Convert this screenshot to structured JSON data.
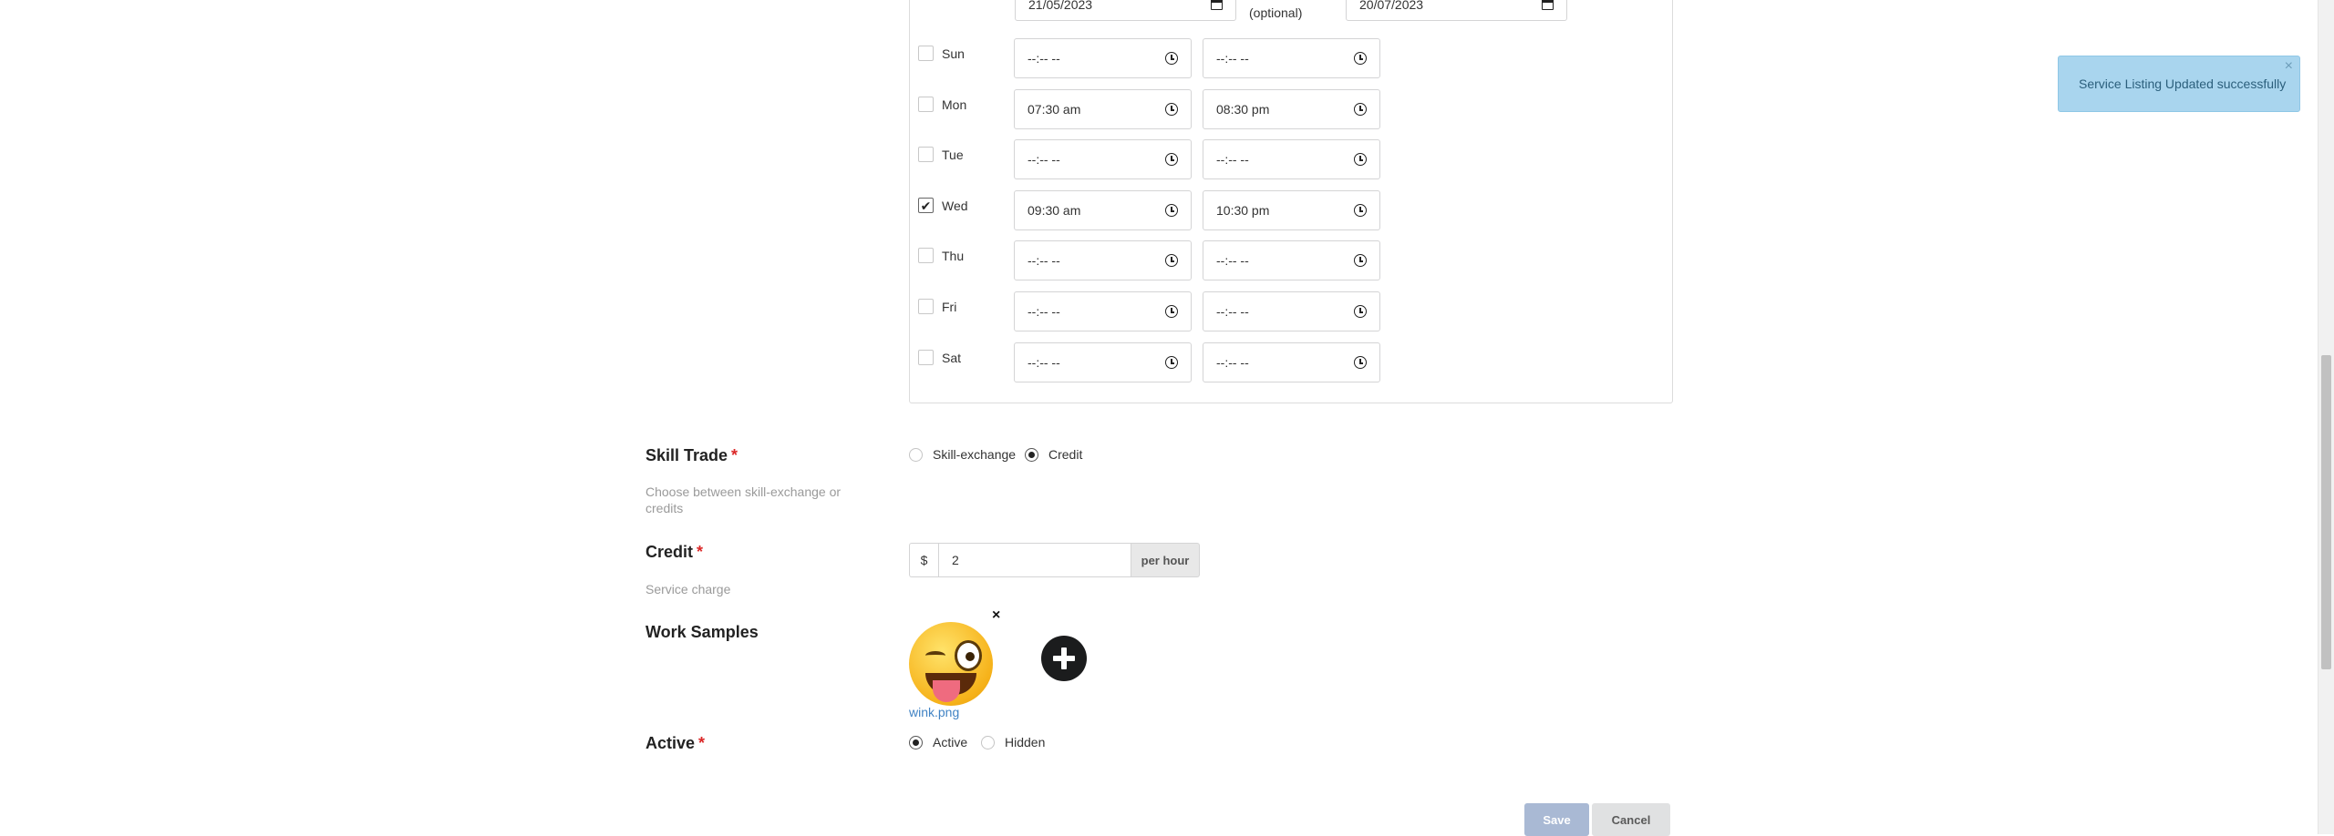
{
  "schedule": {
    "start_date": "21/05/2023",
    "optional_label": "(optional)",
    "end_date": "20/07/2023",
    "days": [
      {
        "label": "Sun",
        "checked": false,
        "from": "--:-- --",
        "to": "--:-- --"
      },
      {
        "label": "Mon",
        "checked": false,
        "from": "07:30 am",
        "to": "08:30 pm"
      },
      {
        "label": "Tue",
        "checked": false,
        "from": "--:-- --",
        "to": "--:-- --"
      },
      {
        "label": "Wed",
        "checked": true,
        "from": "09:30 am",
        "to": "10:30 pm"
      },
      {
        "label": "Thu",
        "checked": false,
        "from": "--:-- --",
        "to": "--:-- --"
      },
      {
        "label": "Fri",
        "checked": false,
        "from": "--:-- --",
        "to": "--:-- --"
      },
      {
        "label": "Sat",
        "checked": false,
        "from": "--:-- --",
        "to": "--:-- --"
      }
    ]
  },
  "skill_trade": {
    "label": "Skill Trade",
    "required_mark": "*",
    "help": "Choose between skill-exchange or credits",
    "options": [
      "Skill-exchange",
      "Credit"
    ],
    "selected": "Credit"
  },
  "credit": {
    "label": "Credit",
    "required_mark": "*",
    "help": "Service charge",
    "prefix": "$",
    "value": "2",
    "suffix": "per hour"
  },
  "work_samples": {
    "label": "Work Samples",
    "file_name": "wink.png",
    "remove_symbol": "×"
  },
  "active": {
    "label": "Active",
    "required_mark": "*",
    "options": [
      "Active",
      "Hidden"
    ],
    "selected": "Active"
  },
  "buttons": {
    "save": "Save",
    "cancel": "Cancel"
  },
  "toast": {
    "message": "Service Listing Updated successfully",
    "close_symbol": "×"
  },
  "colors": {
    "link": "#4183c4",
    "required": "#db2828",
    "toast_bg": "#a9d5ee",
    "save_btn": "#a9b9d4"
  }
}
